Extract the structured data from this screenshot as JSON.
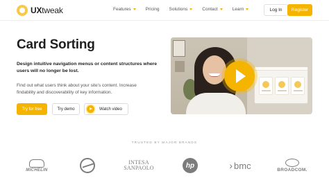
{
  "nav": {
    "logo": {
      "brand_bold": "UX",
      "brand_light": "tweak"
    },
    "menu": [
      {
        "label": "Features",
        "has_dropdown": true
      },
      {
        "label": "Pricing",
        "has_dropdown": false
      },
      {
        "label": "Solutions",
        "has_dropdown": true
      },
      {
        "label": "Contact",
        "has_dropdown": true
      },
      {
        "label": "Learn",
        "has_dropdown": true
      }
    ],
    "login_label": "Log In",
    "register_label": "Register"
  },
  "hero": {
    "title": "Card Sorting",
    "lead": "Design intuitive navigation menus or content structures where users will no longer be lost.",
    "description": "Find out what users think about your site's content. Increase findability and discoverability of key information.",
    "try_label": "Try for free",
    "demo_label": "Try demo",
    "video_label": "Watch video"
  },
  "trusted": {
    "heading": "TRUSTED BY MAJOR BRANDS",
    "brands": {
      "michelin": "MICHELIN",
      "intesa_line1": "INTESA",
      "intesa_line2": "SANPAOLO",
      "hp": "hp",
      "bmc": "bmc",
      "broadcom": "BROADCOM."
    }
  },
  "colors": {
    "accent": "#f5b400",
    "text": "#1f1f1f",
    "muted": "#555555",
    "brand_gray": "#7c7c7c"
  }
}
